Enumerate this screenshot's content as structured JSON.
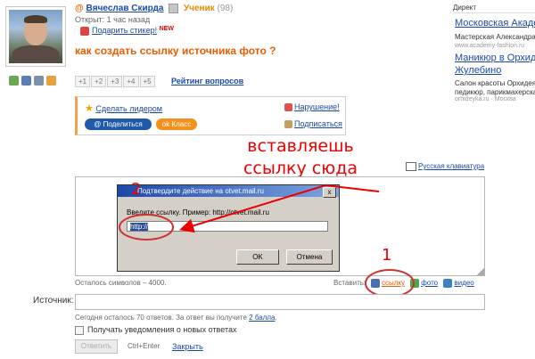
{
  "header": {
    "author": "Вячеслав Скирда",
    "rank": "Ученик",
    "rank_count": "(98)",
    "opened": "Открыт: 1 час назад",
    "sticker_link": "Подарить стикер!",
    "new_badge": "NEW"
  },
  "question": {
    "title": "как создать ссылку источника фото ?"
  },
  "votes": [
    "+1",
    "+2",
    "+3",
    "+4",
    "+5"
  ],
  "rating_link": "Рейтинг вопросов",
  "share": {
    "make_leader": "Сделать лидером",
    "violation": "Нарушение!",
    "share_button": "Поделиться",
    "class_button": "Класс",
    "subscribe": "Подписаться"
  },
  "annotation": {
    "line1": "вставляешь",
    "line2": "ссылку сюда",
    "number1": "1",
    "number2": "2"
  },
  "keyboard_link": "Русская клавиатура",
  "answer": {
    "chars_left": "Осталось символов – 4000.",
    "insert_label": "Вставить:",
    "link_label": "ссылку",
    "photo_label": "фото",
    "video_label": "видео"
  },
  "dialog": {
    "title": "Подтвердите действие на otvet.mail.ru",
    "close": "x",
    "prompt": "Введите ссылку. Пример: http://otvet.mail.ru",
    "input_value": "http://",
    "ok": "OK",
    "cancel": "Отмена"
  },
  "form": {
    "source_label": "Источник:",
    "today_text": "Сегодня осталось 70 ответов. За ответ вы получите",
    "points_link": "2 балла",
    "notify": "Получать уведомления о новых ответах",
    "answer_button": "Ответить",
    "ctrl_enter": "Ctrl+Enter",
    "close_link": "Закрыть"
  },
  "ads": {
    "label": "Директ",
    "items": [
      {
        "title": "Московская Акаде",
        "text": "Мастерская Александра",
        "url": "www.academy-fashion.ru"
      },
      {
        "title1": "Маникюр в Орхиде",
        "title2": "Жулебино",
        "text1": "Салон красоты Орхидея",
        "text2": "педикюр, парикмахерская",
        "url": "orhideyka.ru · Москва"
      }
    ]
  },
  "colors": {
    "accent_orange": "#e65c00",
    "link_blue": "#1a4aa8",
    "annotation_red": "#e00000",
    "share_blue": "#1e5aa8",
    "class_orange": "#f4901c"
  }
}
